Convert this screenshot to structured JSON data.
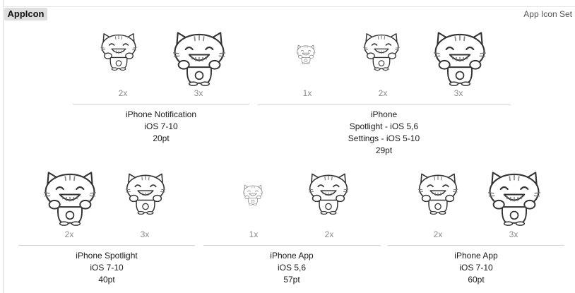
{
  "header": {
    "title": "AppIcon",
    "set_type": "App Icon Set"
  },
  "groups": [
    {
      "slots": [
        {
          "scale": "2x"
        },
        {
          "scale": "3x"
        }
      ],
      "caption": {
        "device": "iPhone Notification",
        "line2": "iOS 7-10",
        "line3": "20pt"
      }
    },
    {
      "slots": [
        {
          "scale": "1x"
        },
        {
          "scale": "2x"
        },
        {
          "scale": "3x"
        }
      ],
      "caption": {
        "device": "iPhone",
        "line2": "Spotlight - iOS 5,6",
        "line3": "Settings - iOS 5-10",
        "line4": "29pt"
      }
    },
    {
      "slots": [
        {
          "scale": "2x"
        },
        {
          "scale": "3x"
        }
      ],
      "caption": {
        "device": "iPhone Spotlight",
        "line2": "iOS 7-10",
        "line3": "40pt"
      }
    },
    {
      "slots": [
        {
          "scale": "1x"
        },
        {
          "scale": "2x"
        }
      ],
      "caption": {
        "device": "iPhone App",
        "line2": "iOS 5,6",
        "line3": "57pt"
      }
    },
    {
      "slots": [
        {
          "scale": "2x"
        },
        {
          "scale": "3x"
        }
      ],
      "caption": {
        "device": "iPhone App",
        "line2": "iOS 7-10",
        "line3": "60pt"
      }
    }
  ]
}
